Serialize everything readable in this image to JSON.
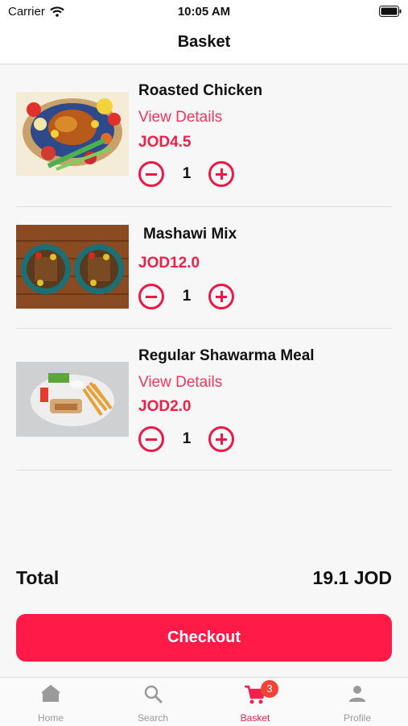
{
  "status_bar": {
    "carrier": "Carrier",
    "time": "10:05 AM"
  },
  "navbar": {
    "title": "Basket"
  },
  "items": [
    {
      "name": "Roasted Chicken",
      "details": "View Details",
      "price": "JOD4.5",
      "quantity": "1"
    },
    {
      "name": "Mashawi Mix",
      "price": "JOD12.0",
      "quantity": "1"
    },
    {
      "name": "Regular Shawarma Meal",
      "details": "View Details",
      "price": "JOD2.0",
      "quantity": "1"
    }
  ],
  "summary": {
    "total_label": "Total",
    "total_value": "19.1 JOD"
  },
  "checkout": {
    "label": "Checkout"
  },
  "tabbar": {
    "tabs": [
      {
        "label": "Home",
        "icon": "home-icon"
      },
      {
        "label": "Search",
        "icon": "search-icon"
      },
      {
        "label": "Basket",
        "icon": "cart-icon",
        "badge": "3",
        "active": true
      },
      {
        "label": "Profile",
        "icon": "person-icon"
      }
    ]
  },
  "colors": {
    "accent": "#ff1a47",
    "price": "#f01f49",
    "link": "#f1375d",
    "badge": "#f44336"
  }
}
